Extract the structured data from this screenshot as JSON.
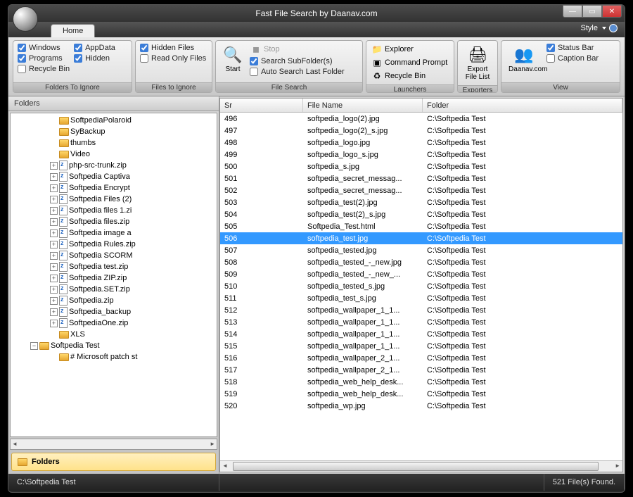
{
  "window": {
    "title": "Fast File Search by Daanav.com",
    "min": "—",
    "max": "▭",
    "close": "✕"
  },
  "tabs": {
    "home": "Home",
    "style": "Style"
  },
  "ribbon": {
    "foldersIgnore": {
      "label": "Folders To Ignore",
      "windows": "Windows",
      "appData": "AppData",
      "programs": "Programs",
      "hidden": "Hidden",
      "recycle": "Recycle Bin"
    },
    "filesIgnore": {
      "label": "Files to Ignore",
      "hiddenFiles": "Hidden Files",
      "readOnly": "Read Only Files"
    },
    "fileSearch": {
      "label": "File Search",
      "start": "Start",
      "stop": "Stop",
      "subFolders": "Search SubFolder(s)",
      "autoLast": "Auto Search Last Folder"
    },
    "launchers": {
      "label": "Launchers",
      "explorer": "Explorer",
      "cmd": "Command Prompt",
      "recycle": "Recycle Bin"
    },
    "exporters": {
      "label": "Exporters",
      "export": "Export File List"
    },
    "view": {
      "label": "View",
      "daanav": "Daanav.com",
      "statusBar": "Status Bar",
      "captionBar": "Caption Bar"
    }
  },
  "leftPanel": {
    "header": "Folders",
    "folders": "Folders",
    "tree": [
      {
        "indent": 4,
        "exp": "none",
        "icon": "folder",
        "label": "SoftpediaPolaroid"
      },
      {
        "indent": 4,
        "exp": "none",
        "icon": "folder",
        "label": "SyBackup"
      },
      {
        "indent": 4,
        "exp": "none",
        "icon": "folder",
        "label": "thumbs"
      },
      {
        "indent": 4,
        "exp": "none",
        "icon": "folder",
        "label": "Video"
      },
      {
        "indent": 4,
        "exp": "plus",
        "icon": "zip",
        "label": "php-src-trunk.zip"
      },
      {
        "indent": 4,
        "exp": "plus",
        "icon": "zip",
        "label": "Softpedia Captiva"
      },
      {
        "indent": 4,
        "exp": "plus",
        "icon": "zip",
        "label": "Softpedia Encrypt"
      },
      {
        "indent": 4,
        "exp": "plus",
        "icon": "zip",
        "label": "Softpedia Files (2)"
      },
      {
        "indent": 4,
        "exp": "plus",
        "icon": "zip",
        "label": "Softpedia files 1.zi"
      },
      {
        "indent": 4,
        "exp": "plus",
        "icon": "zip",
        "label": "Softpedia files.zip"
      },
      {
        "indent": 4,
        "exp": "plus",
        "icon": "zip",
        "label": "Softpedia image a"
      },
      {
        "indent": 4,
        "exp": "plus",
        "icon": "zip",
        "label": "Softpedia Rules.zip"
      },
      {
        "indent": 4,
        "exp": "plus",
        "icon": "zip",
        "label": "Softpedia SCORM"
      },
      {
        "indent": 4,
        "exp": "plus",
        "icon": "zip",
        "label": "Softpedia test.zip"
      },
      {
        "indent": 4,
        "exp": "plus",
        "icon": "zip",
        "label": "Softpedia ZIP.zip"
      },
      {
        "indent": 4,
        "exp": "plus",
        "icon": "zip",
        "label": "Softpedia.SET.zip"
      },
      {
        "indent": 4,
        "exp": "plus",
        "icon": "zip",
        "label": "Softpedia.zip"
      },
      {
        "indent": 4,
        "exp": "plus",
        "icon": "zip",
        "label": "Softpedia_backup"
      },
      {
        "indent": 4,
        "exp": "plus",
        "icon": "zip",
        "label": "SoftpediaOne.zip"
      },
      {
        "indent": 4,
        "exp": "none",
        "icon": "folder",
        "label": "XLS"
      },
      {
        "indent": 2,
        "exp": "minus",
        "icon": "folder",
        "label": "Softpedia Test"
      },
      {
        "indent": 4,
        "exp": "none",
        "icon": "folder",
        "label": "# Microsoft patch st"
      }
    ]
  },
  "table": {
    "headers": {
      "sr": "Sr",
      "fileName": "File Name",
      "folder": "Folder"
    },
    "selectedSr": 506,
    "rows": [
      {
        "sr": 496,
        "fn": "softpedia_logo(2).jpg",
        "fd": "C:\\Softpedia Test"
      },
      {
        "sr": 497,
        "fn": "softpedia_logo(2)_s.jpg",
        "fd": "C:\\Softpedia Test"
      },
      {
        "sr": 498,
        "fn": "softpedia_logo.jpg",
        "fd": "C:\\Softpedia Test"
      },
      {
        "sr": 499,
        "fn": "softpedia_logo_s.jpg",
        "fd": "C:\\Softpedia Test"
      },
      {
        "sr": 500,
        "fn": "softpedia_s.jpg",
        "fd": "C:\\Softpedia Test"
      },
      {
        "sr": 501,
        "fn": "softpedia_secret_messag...",
        "fd": "C:\\Softpedia Test"
      },
      {
        "sr": 502,
        "fn": "softpedia_secret_messag...",
        "fd": "C:\\Softpedia Test"
      },
      {
        "sr": 503,
        "fn": "softpedia_test(2).jpg",
        "fd": "C:\\Softpedia Test"
      },
      {
        "sr": 504,
        "fn": "softpedia_test(2)_s.jpg",
        "fd": "C:\\Softpedia Test"
      },
      {
        "sr": 505,
        "fn": "Softpedia_Test.html",
        "fd": "C:\\Softpedia Test"
      },
      {
        "sr": 506,
        "fn": "softpedia_test.jpg",
        "fd": "C:\\Softpedia Test"
      },
      {
        "sr": 507,
        "fn": "softpedia_tested.jpg",
        "fd": "C:\\Softpedia Test"
      },
      {
        "sr": 508,
        "fn": "softpedia_tested_-_new.jpg",
        "fd": "C:\\Softpedia Test"
      },
      {
        "sr": 509,
        "fn": "softpedia_tested_-_new_...",
        "fd": "C:\\Softpedia Test"
      },
      {
        "sr": 510,
        "fn": "softpedia_tested_s.jpg",
        "fd": "C:\\Softpedia Test"
      },
      {
        "sr": 511,
        "fn": "softpedia_test_s.jpg",
        "fd": "C:\\Softpedia Test"
      },
      {
        "sr": 512,
        "fn": "softpedia_wallpaper_1_1...",
        "fd": "C:\\Softpedia Test"
      },
      {
        "sr": 513,
        "fn": "softpedia_wallpaper_1_1...",
        "fd": "C:\\Softpedia Test"
      },
      {
        "sr": 514,
        "fn": "softpedia_wallpaper_1_1...",
        "fd": "C:\\Softpedia Test"
      },
      {
        "sr": 515,
        "fn": "softpedia_wallpaper_1_1...",
        "fd": "C:\\Softpedia Test"
      },
      {
        "sr": 516,
        "fn": "softpedia_wallpaper_2_1...",
        "fd": "C:\\Softpedia Test"
      },
      {
        "sr": 517,
        "fn": "softpedia_wallpaper_2_1...",
        "fd": "C:\\Softpedia Test"
      },
      {
        "sr": 518,
        "fn": "softpedia_web_help_desk...",
        "fd": "C:\\Softpedia Test"
      },
      {
        "sr": 519,
        "fn": "softpedia_web_help_desk...",
        "fd": "C:\\Softpedia Test"
      },
      {
        "sr": 520,
        "fn": "softpedia_wp.jpg",
        "fd": "C:\\Softpedia Test"
      }
    ]
  },
  "status": {
    "path": "C:\\Softpedia Test",
    "count": "521 File(s) Found."
  }
}
